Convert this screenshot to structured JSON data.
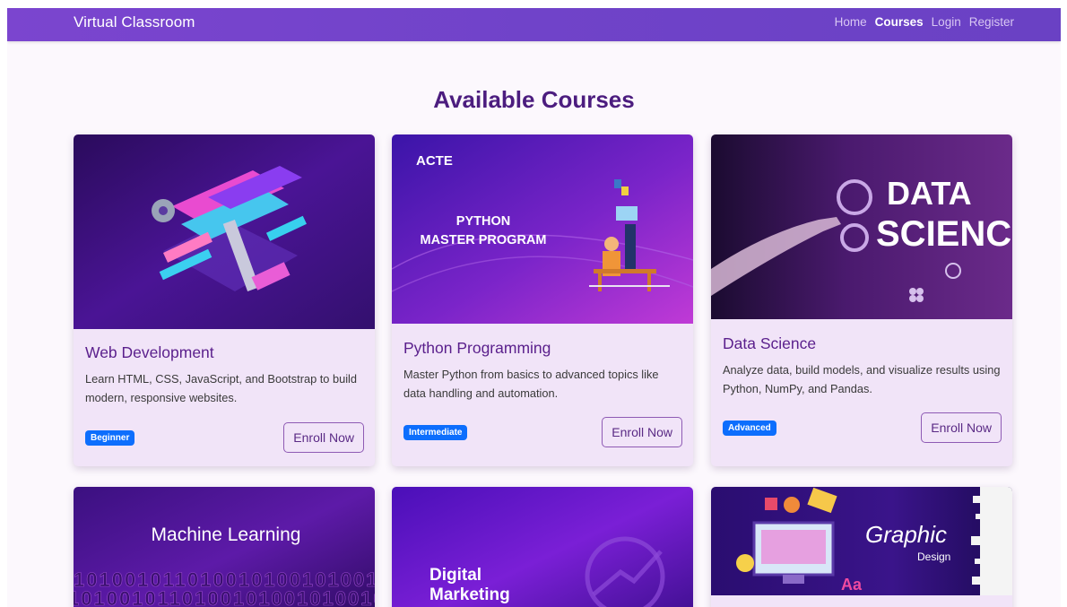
{
  "nav": {
    "brand": "Virtual Classroom",
    "links": [
      {
        "label": "Home"
      },
      {
        "label": "Courses"
      },
      {
        "label": "Login"
      },
      {
        "label": "Register"
      }
    ]
  },
  "main": {
    "heading": "Available Courses",
    "courses": [
      {
        "title": "Web Development",
        "description": "Learn HTML, CSS, JavaScript, and Bootstrap to build modern, responsive websites.",
        "level": "Beginner",
        "button": "Enroll Now"
      },
      {
        "title": "Python Programming",
        "description": "Master Python from basics to advanced topics like data handling and automation.",
        "level": "Intermediate",
        "button": "Enroll Now",
        "image_text": {
          "brand": "ACTE",
          "line1": "PYTHON",
          "line2": "MASTER PROGRAM"
        }
      },
      {
        "title": "Data Science",
        "description": "Analyze data, build models, and visualize results using Python, NumPy, and Pandas.",
        "level": "Advanced",
        "button": "Enroll Now",
        "image_text": {
          "line1": "DATA",
          "line2": "SCIENCE"
        }
      },
      {
        "image_text": {
          "line1": "Machine Learning",
          "binary": "10100101101001010010100101"
        }
      },
      {
        "image_text": {
          "line1": "Digital",
          "line2": "Marketing"
        }
      },
      {
        "image_text": {
          "line1": "Graphic",
          "line2": "Design",
          "glyph": "Aa"
        }
      }
    ]
  },
  "colors": {
    "navbar": "#7043c9",
    "heading": "#4c1d7f",
    "card_bg": "#f1e4f8",
    "badge": "#0d6efd",
    "button_border": "#8e5ab4"
  }
}
